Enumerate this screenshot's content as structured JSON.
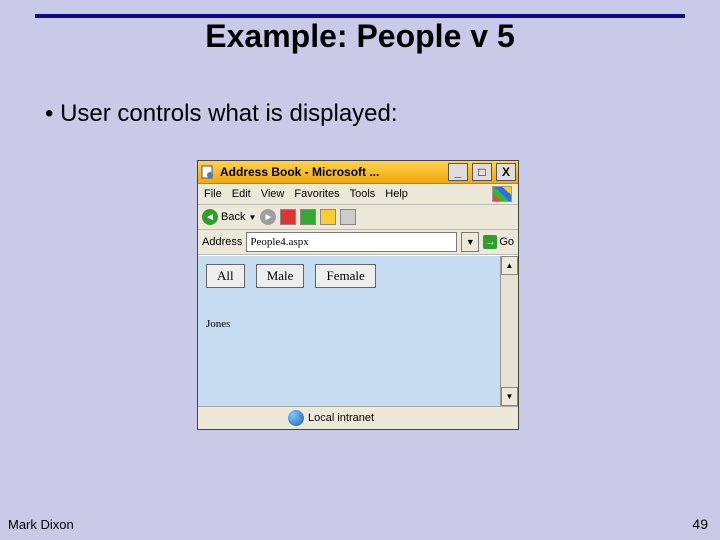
{
  "slide": {
    "title": "Example: People v 5",
    "bullet": "•  User controls what is displayed:",
    "footer_left": "Mark Dixon",
    "footer_right": "49"
  },
  "browser": {
    "window_title": "Address Book - Microsoft ...",
    "menu": {
      "file": "File",
      "edit": "Edit",
      "view": "View",
      "fav": "Favorites",
      "tools": "Tools",
      "help": "Help"
    },
    "toolbar": {
      "back": "Back"
    },
    "address": {
      "label": "Address",
      "value": "People4.aspx",
      "go": "Go"
    },
    "page": {
      "buttons": {
        "all": "All",
        "male": "Male",
        "female": "Female"
      },
      "result": "Jones"
    },
    "status": "Local intranet"
  }
}
